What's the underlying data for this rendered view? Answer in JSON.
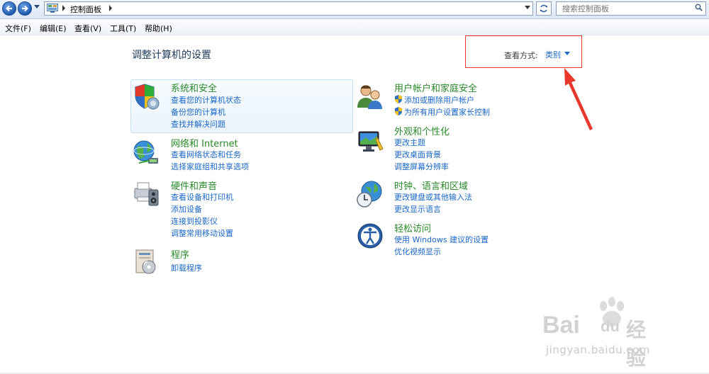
{
  "address_bar": {
    "crumb": "控制面板"
  },
  "search": {
    "placeholder": "搜索控制面板"
  },
  "menu": [
    "文件(F)",
    "编辑(E)",
    "查看(V)",
    "工具(T)",
    "帮助(H)"
  ],
  "page_title": "调整计算机的设置",
  "view_by": {
    "label": "查看方式:",
    "value": "类别"
  },
  "categories": {
    "system_security": {
      "title": "系统和安全",
      "links": [
        "查看您的计算机状态",
        "备份您的计算机",
        "查找并解决问题"
      ]
    },
    "network": {
      "title": "网络和 Internet",
      "links": [
        "查看网络状态和任务",
        "选择家庭组和共享选项"
      ]
    },
    "hardware": {
      "title": "硬件和声音",
      "links": [
        "查看设备和打印机",
        "添加设备",
        "连接到投影仪",
        "调整常用移动设置"
      ]
    },
    "programs": {
      "title": "程序",
      "links": [
        "卸载程序"
      ]
    },
    "user_accounts": {
      "title": "用户帐户和家庭安全",
      "links": [
        "添加或删除用户帐户",
        "为所有用户设置家长控制"
      ]
    },
    "appearance": {
      "title": "外观和个性化",
      "links": [
        "更改主题",
        "更改桌面背景",
        "调整屏幕分辨率"
      ]
    },
    "clock": {
      "title": "时钟、语言和区域",
      "links": [
        "更改键盘或其他输入法",
        "更改显示语言"
      ]
    },
    "ease": {
      "title": "轻松访问",
      "links": [
        "使用 Windows 建议的设置",
        "优化视频显示"
      ]
    }
  },
  "watermark": {
    "brand": "Bai",
    "brand2": "du",
    "cn": "经验",
    "url": "jingyan.baidu.com"
  },
  "colors": {
    "link": "#1a67c8",
    "category_title": "#2a8a2a",
    "annotation": "#e8382b"
  }
}
